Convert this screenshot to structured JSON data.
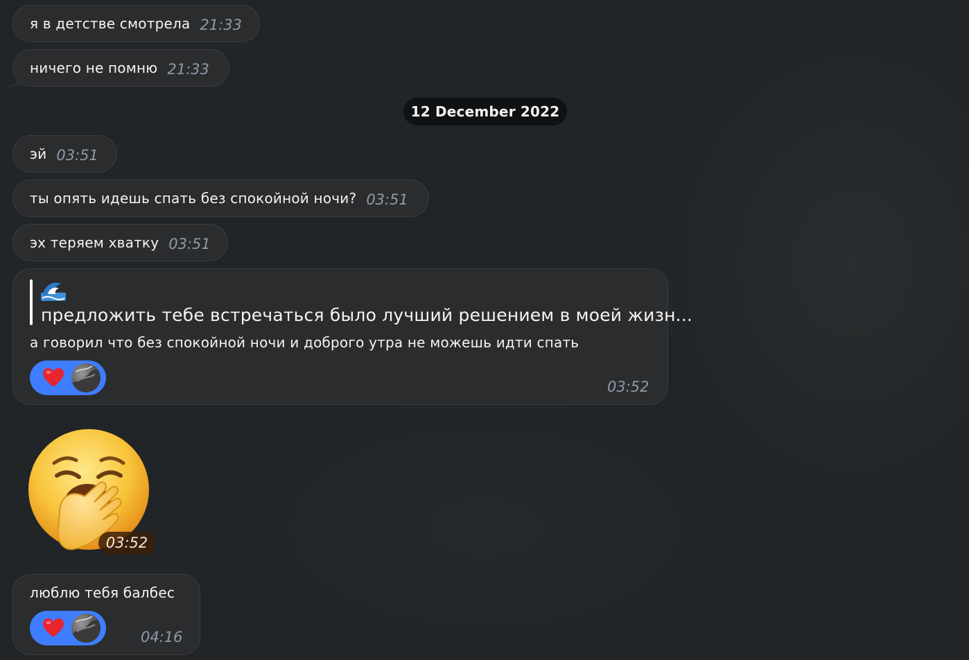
{
  "messages": [
    {
      "text": "я в детстве смотрела",
      "time": "21:33"
    },
    {
      "text": "ничего не помню",
      "time": "21:33"
    },
    {
      "text": "эй",
      "time": "03:51"
    },
    {
      "text": "ты опять идешь спать без спокойной ночи?",
      "time": "03:51"
    },
    {
      "text": "эх теряем хватку",
      "time": "03:51"
    }
  ],
  "date_separator": "12 December 2022",
  "reply_message": {
    "quote_icon": "wave-icon",
    "quote_text": "предложить тебе встречаться было лучший решением в моей жизн...",
    "text": "а говорил что без спокойной ночи и доброго утра не можешь идти спать",
    "time": "03:52",
    "reaction": {
      "emoji": "heart-icon",
      "color": "#3f7dff"
    }
  },
  "sticker": {
    "icon": "yawning-face-icon",
    "time": "03:52"
  },
  "last_message": {
    "text": "люблю тебя балбес",
    "time": "04:16",
    "reaction": {
      "emoji": "heart-icon",
      "color": "#3f7dff"
    }
  },
  "colors": {
    "background": "#222527",
    "bubble": "#2b2c2e",
    "time_text": "#8e9aa8",
    "reaction": "#3f7dff",
    "date_pill": "#0f1113"
  }
}
